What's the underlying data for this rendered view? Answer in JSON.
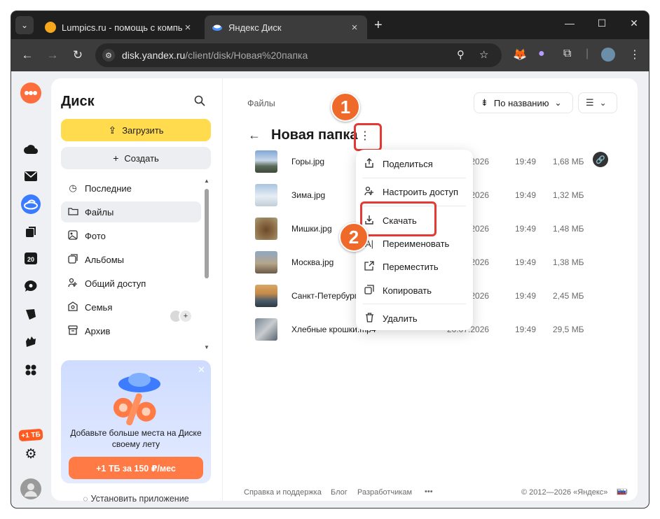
{
  "browser": {
    "tabs": [
      {
        "title": "Lumpics.ru - помощь с компь",
        "active": false
      },
      {
        "title": "Яндекс Диск",
        "active": true
      }
    ],
    "new_tab": "+",
    "url_host": "disk.yandex.ru",
    "url_path": "/client/disk/Новая%20папка"
  },
  "sidebar": {
    "brand": "Диск",
    "upload_label": "Загрузить",
    "create_label": "Создать",
    "items": [
      {
        "label": "Последние",
        "icon": "clock-icon"
      },
      {
        "label": "Файлы",
        "icon": "folder-icon"
      },
      {
        "label": "Фото",
        "icon": "photo-icon"
      },
      {
        "label": "Альбомы",
        "icon": "albums-icon"
      },
      {
        "label": "Общий доступ",
        "icon": "shared-icon"
      },
      {
        "label": "Семья",
        "icon": "family-icon"
      },
      {
        "label": "Архив",
        "icon": "archive-icon"
      }
    ],
    "promo": {
      "text": "Добавьте больше места на Диске своему лету",
      "button": "+1 ТБ за 150 ₽/мес"
    },
    "install_app": "Установить приложение",
    "rail_badge": "+1 ТБ",
    "rail_calendar": "20"
  },
  "main": {
    "breadcrumb": "Файлы",
    "sort_label": "По названию",
    "folder_title": "Новая папка",
    "files": [
      {
        "name": "Горы.jpg",
        "date": "20.07.2026",
        "time": "19:49",
        "size": "1,68 МБ"
      },
      {
        "name": "Зима.jpg",
        "date": "20.07.2026",
        "time": "19:49",
        "size": "1,32 МБ"
      },
      {
        "name": "Мишки.jpg",
        "date": "20.07.2026",
        "time": "19:49",
        "size": "1,48 МБ"
      },
      {
        "name": "Москва.jpg",
        "date": "20.07.2026",
        "time": "19:49",
        "size": "1,38 МБ"
      },
      {
        "name": "Санкт-Петербург.jpg",
        "date": "20.07.2026",
        "time": "19:49",
        "size": "2,45 МБ"
      },
      {
        "name": "Хлебные крошки.mp4",
        "date": "20.07.2026",
        "time": "19:49",
        "size": "29,5 МБ"
      }
    ],
    "context_menu": [
      {
        "label": "Поделиться",
        "icon": "share-icon"
      },
      {
        "label": "Настроить доступ",
        "icon": "access-icon"
      },
      {
        "label": "Скачать",
        "icon": "download-icon"
      },
      {
        "label": "Переименовать",
        "icon": "rename-icon"
      },
      {
        "label": "Переместить",
        "icon": "move-icon"
      },
      {
        "label": "Копировать",
        "icon": "copy-icon"
      },
      {
        "label": "Удалить",
        "icon": "trash-icon"
      }
    ],
    "annotations": [
      "1",
      "2"
    ],
    "footer": {
      "support": "Справка и поддержка",
      "blog": "Блог",
      "developers": "Разработчикам",
      "more": "•••",
      "copyright": "© 2012—2026 «Яндекс»",
      "lang": "RU"
    }
  },
  "colors": {
    "accent_yellow": "#ffdb4d",
    "promo_orange": "#ff7a45",
    "annotation_red": "#e53935",
    "annotation_badge": "#ef6a2a"
  }
}
